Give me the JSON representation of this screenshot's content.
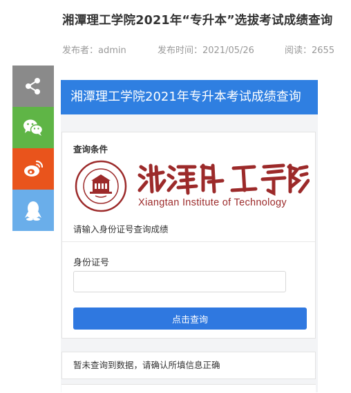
{
  "article": {
    "title": "湘潭理工学院2021年“专升本”选拔考试成绩查询",
    "author": "发布者：admin",
    "publish_time": "发布时间：2021/05/26",
    "views": "阅读：2655"
  },
  "share": {
    "icons": [
      "share-icon",
      "wechat-icon",
      "weibo-icon",
      "qq-icon"
    ]
  },
  "query": {
    "header": "湘潭理工学院2021年专升本考试成绩查询",
    "section_label": "查询条件",
    "logo": {
      "name_cn": "湘潭理工学院",
      "name_en": "Xiangtan Institute of Technology",
      "seal_text": "XIANGTAN INSTITUTE OF TECHNOLOGY"
    },
    "hint": "请输入身份证号查询成绩",
    "id_label": "身份证号",
    "id_value": "",
    "id_placeholder": "",
    "submit_label": "点击查询",
    "result_message": "暂未查询到数据，请确认所填信息正确"
  },
  "colors": {
    "header_blue": "#2f7fe1",
    "button_blue": "#2f78e0",
    "logo_red": "#9c2a2a",
    "share_gray": "#8a8a8a",
    "share_wechat": "#5fb546",
    "share_weibo": "#e9541c",
    "share_qq": "#6aaeea"
  }
}
